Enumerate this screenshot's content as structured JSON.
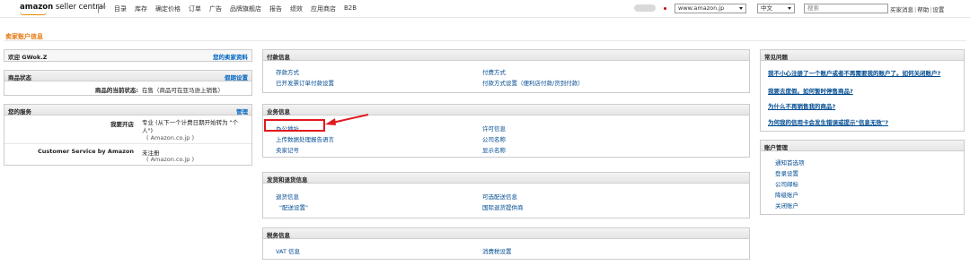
{
  "header": {
    "logo_main": "amazon",
    "logo_sub": " seller central",
    "nav": [
      "目录",
      "库存",
      "确定价格",
      "订单",
      "广告",
      "品牌旗舰店",
      "报告",
      "绩效",
      "应用商店",
      "B2B"
    ],
    "marketplace": "www.amazon.jp",
    "language": "中文",
    "search_placeholder": "搜索",
    "links": [
      "买家消息",
      "帮助",
      "设置"
    ]
  },
  "page_title": "卖家账户信息",
  "welcome_box": {
    "welcome": "欢迎 GWok.Z",
    "link": "您的卖家资料"
  },
  "listing_status": {
    "title": "商品状态",
    "link": "假期设置",
    "label": "商品的当前状态:",
    "value": "在售（商品可在亚马逊上销售）"
  },
  "services": {
    "title": "您的服务",
    "link": "管理",
    "items": [
      {
        "label": "我要开店",
        "value": "专业 (从下一个计费日期开始转为 \"个人\")",
        "sub": "( Amazon.co.jp )"
      },
      {
        "label": "Customer Service by Amazon",
        "value": "未注册",
        "sub": "( Amazon.co.jp )"
      }
    ]
  },
  "payment_info": {
    "title": "付款信息",
    "left": [
      "存款方式",
      "已开发票订单付款设置"
    ],
    "right": [
      "付费方式",
      "付款方式设置（便利店付款/货到付款）"
    ]
  },
  "business_info": {
    "title": "业务信息",
    "left": [
      "办公地址",
      "上传数据处理报告语言",
      "卖家记号"
    ],
    "right": [
      "许可信息",
      "公司名称",
      "显示名称"
    ]
  },
  "shipping_info": {
    "title": "发货和退货信息",
    "left": [
      "退货信息",
      "\"配送设置\""
    ],
    "right": [
      "可选配送信息",
      "国际退货提供商"
    ]
  },
  "tax_info": {
    "title": "税务信息",
    "left": [
      "VAT 信息"
    ],
    "right": [
      "消费税设置"
    ]
  },
  "faq": {
    "title": "常见问题",
    "items": [
      "我不小心注册了一个账户或者不再需要我的账户了。如何关闭账户?",
      "我要去度假。如何暂时停售商品?",
      "为什么不再销售我的商品?",
      "为何我的信用卡会发生错误或提示\"信息无效\"?"
    ]
  },
  "account_mgmt": {
    "title": "账户管理",
    "items": [
      "通知首选项",
      "登录设置",
      "公司邮标",
      "降级账户",
      "关闭账户"
    ]
  },
  "colors": {
    "accent": "#e47911",
    "link": "#004b91",
    "highlight": "#e0191e"
  }
}
